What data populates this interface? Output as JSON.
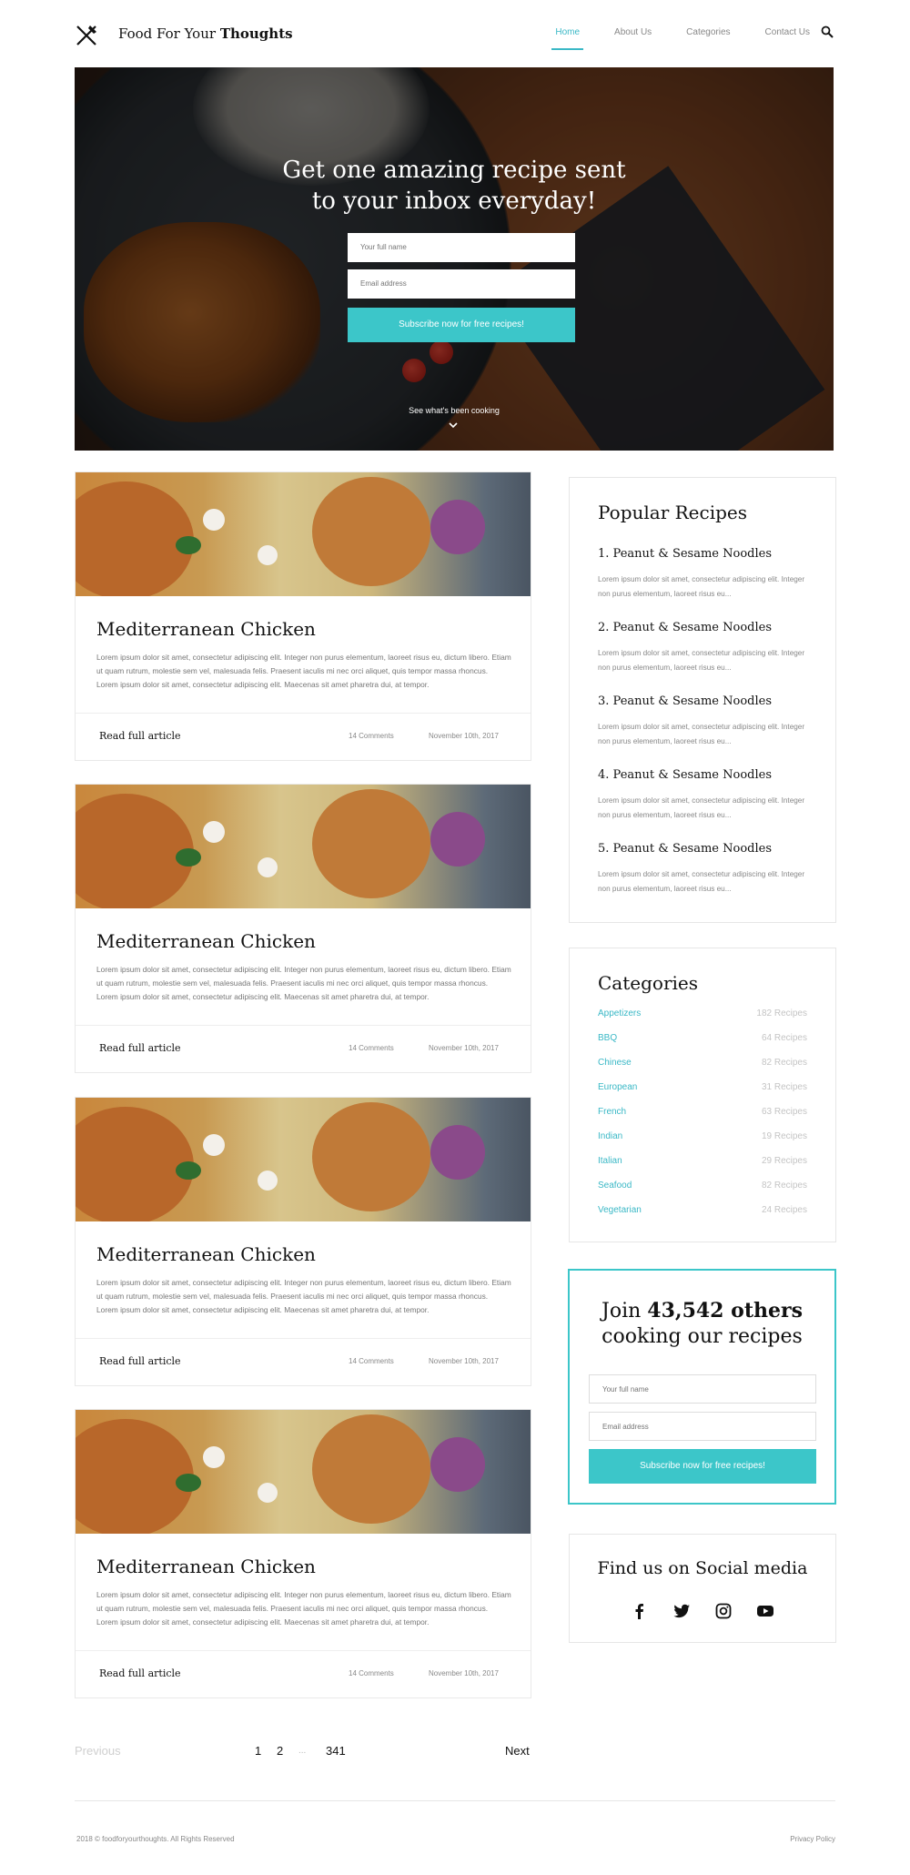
{
  "header": {
    "brand_regular": "Food For Your",
    "brand_bold": "Thoughts",
    "nav": [
      {
        "label": "Home"
      },
      {
        "label": "About Us"
      },
      {
        "label": "Categories"
      },
      {
        "label": "Contact Us"
      }
    ],
    "active_nav": "Home",
    "icons": {
      "logo": "fork-knife-icon",
      "search": "search-icon"
    }
  },
  "hero": {
    "title_line1": "Get one amazing recipe sent",
    "title_line2": "to your inbox everyday!",
    "name_placeholder": "Your full name",
    "email_placeholder": "Email address",
    "subscribe_label": "Subscribe now for free recipes!",
    "see_more": "See what's been cooking"
  },
  "articles": [
    {
      "title": "Mediterranean Chicken",
      "body": "Lorem ipsum dolor sit amet, consectetur adipiscing elit. Integer non purus elementum, laoreet risus eu, dictum libero. Etiam ut quam rutrum, molestie sem vel, malesuada felis. Praesent iaculis mi nec orci aliquet, quis tempor massa rhoncus. Lorem ipsum dolor sit amet, consectetur adipiscing elit. Maecenas sit amet pharetra dui, at tempor.",
      "read": "Read full article",
      "comments": "14 Comments",
      "date": "November 10th, 2017"
    },
    {
      "title": "Mediterranean Chicken",
      "body": "Lorem ipsum dolor sit amet, consectetur adipiscing elit. Integer non purus elementum, laoreet risus eu, dictum libero. Etiam ut quam rutrum, molestie sem vel, malesuada felis. Praesent iaculis mi nec orci aliquet, quis tempor massa rhoncus. Lorem ipsum dolor sit amet, consectetur adipiscing elit. Maecenas sit amet pharetra dui, at tempor.",
      "read": "Read full article",
      "comments": "14 Comments",
      "date": "November 10th, 2017"
    },
    {
      "title": "Mediterranean Chicken",
      "body": "Lorem ipsum dolor sit amet, consectetur adipiscing elit. Integer non purus elementum, laoreet risus eu, dictum libero. Etiam ut quam rutrum, molestie sem vel, malesuada felis. Praesent iaculis mi nec orci aliquet, quis tempor massa rhoncus. Lorem ipsum dolor sit amet, consectetur adipiscing elit. Maecenas sit amet pharetra dui, at tempor.",
      "read": "Read full article",
      "comments": "14 Comments",
      "date": "November 10th, 2017"
    },
    {
      "title": "Mediterranean Chicken",
      "body": "Lorem ipsum dolor sit amet, consectetur adipiscing elit. Integer non purus elementum, laoreet risus eu, dictum libero. Etiam ut quam rutrum, molestie sem vel, malesuada felis. Praesent iaculis mi nec orci aliquet, quis tempor massa rhoncus. Lorem ipsum dolor sit amet, consectetur adipiscing elit. Maecenas sit amet pharetra dui, at tempor.",
      "read": "Read full article",
      "comments": "14 Comments",
      "date": "November 10th, 2017"
    }
  ],
  "popular": {
    "title": "Popular Recipes",
    "items": [
      {
        "title": "1. Peanut & Sesame Noodles",
        "desc": "Lorem ipsum dolor sit amet, consectetur adipiscing elit. Integer non purus elementum, laoreet risus eu..."
      },
      {
        "title": "2. Peanut & Sesame Noodles",
        "desc": "Lorem ipsum dolor sit amet, consectetur adipiscing elit. Integer non purus elementum, laoreet risus eu..."
      },
      {
        "title": "3. Peanut & Sesame Noodles",
        "desc": "Lorem ipsum dolor sit amet, consectetur adipiscing elit. Integer non purus elementum, laoreet risus eu..."
      },
      {
        "title": "4. Peanut & Sesame Noodles",
        "desc": "Lorem ipsum dolor sit amet, consectetur adipiscing elit. Integer non purus elementum, laoreet risus eu..."
      },
      {
        "title": "5. Peanut & Sesame Noodles",
        "desc": "Lorem ipsum dolor sit amet, consectetur adipiscing elit. Integer non purus elementum, laoreet risus eu..."
      }
    ]
  },
  "categories": {
    "title": "Categories",
    "items": [
      {
        "name": "Appetizers",
        "count": "182 Recipes"
      },
      {
        "name": "BBQ",
        "count": "64 Recipes"
      },
      {
        "name": "Chinese",
        "count": "82 Recipes"
      },
      {
        "name": "European",
        "count": "31 Recipes"
      },
      {
        "name": "French",
        "count": "63 Recipes"
      },
      {
        "name": "Indian",
        "count": "19 Recipes"
      },
      {
        "name": "Italian",
        "count": "29 Recipes"
      },
      {
        "name": "Seafood",
        "count": "82 Recipes"
      },
      {
        "name": "Vegetarian",
        "count": "24 Recipes"
      }
    ]
  },
  "join": {
    "title_prefix": "Join",
    "title_count": "43,542 others",
    "title_line2": "cooking our recipes",
    "name_placeholder": "Your full name",
    "email_placeholder": "Email address",
    "subscribe_label": "Subscribe now for free recipes!"
  },
  "social": {
    "title": "Find us on Social media",
    "icons": [
      "facebook-icon",
      "twitter-icon",
      "instagram-icon",
      "youtube-icon"
    ]
  },
  "pagination": {
    "previous": "Previous",
    "pages": [
      "1",
      "2",
      "...",
      "341"
    ],
    "next": "Next"
  },
  "footer": {
    "copyright": "2018 © foodforyourthoughts. All Rights Reserved",
    "policy": "Privacy Policy"
  },
  "colors": {
    "accent": "#3cc6c9",
    "link": "#3ab8c6",
    "muted": "#888888"
  }
}
